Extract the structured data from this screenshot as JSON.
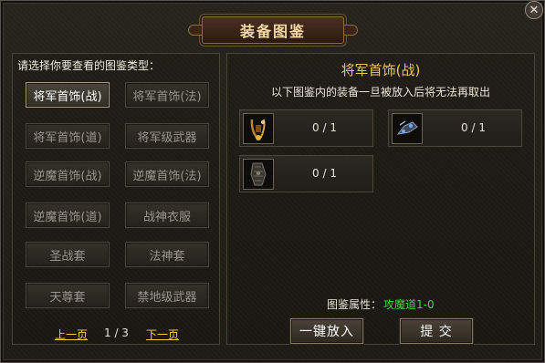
{
  "window": {
    "title": "装备图鉴",
    "close_glyph": "✕"
  },
  "left": {
    "prompt": "请选择你要查看的图鉴类型：",
    "categories": [
      {
        "label": "将军首饰(战)",
        "active": true
      },
      {
        "label": "将军首饰(法)",
        "active": false
      },
      {
        "label": "将军首饰(道)",
        "active": false
      },
      {
        "label": "将军级武器",
        "active": false
      },
      {
        "label": "逆魔首饰(战)",
        "active": false
      },
      {
        "label": "逆魔首饰(法)",
        "active": false
      },
      {
        "label": "逆魔首饰(道)",
        "active": false
      },
      {
        "label": "战神衣服",
        "active": false
      },
      {
        "label": "圣战套",
        "active": false
      },
      {
        "label": "法神套",
        "active": false
      },
      {
        "label": "天尊套",
        "active": false
      },
      {
        "label": "禁地级武器",
        "active": false
      }
    ],
    "pager": {
      "prev": "上一页",
      "page": "1 / 3",
      "next": "下一页"
    }
  },
  "right": {
    "set_title": "将军首饰(战)",
    "notice": "以下图鉴内的装备一旦被放入后将无法再取出",
    "slots": [
      {
        "icon": "necklace-icon",
        "count": "0 / 1"
      },
      {
        "icon": "bracelet-icon",
        "count": "0 / 1"
      },
      {
        "icon": "ring-glove-icon",
        "count": "0 / 1"
      }
    ],
    "attr_label": "图鉴属性：",
    "attr_value": "攻魔道1-0",
    "buttons": {
      "put_all": "一键放入",
      "submit": "提 交"
    }
  },
  "colors": {
    "title_gold": "#f0c65e",
    "attr_green": "#3fd43f",
    "pager_yellow": "#f2d23a"
  }
}
